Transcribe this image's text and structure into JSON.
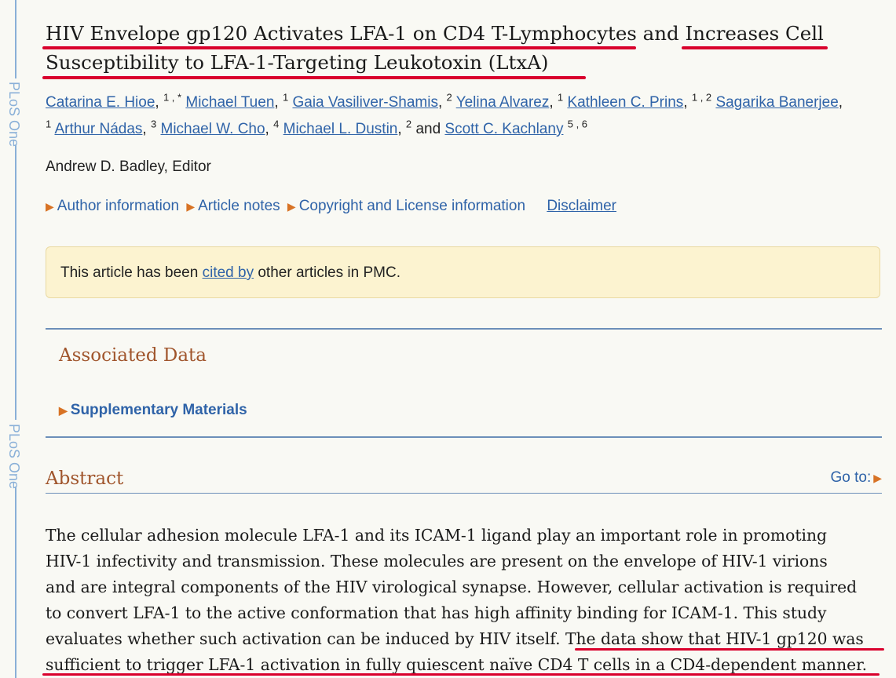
{
  "sidebar": {
    "journal_label": "PLoS One"
  },
  "article": {
    "title_lines": [
      "HIV Envelope gp120 Activates LFA-1 on CD4 T-Lymphocytes and Increases Cell",
      "Susceptibility to LFA-1-Targeting Leukotoxin (LtxA)"
    ],
    "authors": [
      {
        "name": "Catarina E. Hioe",
        "sup": "1 , *"
      },
      {
        "name": "Michael Tuen",
        "sup": "1"
      },
      {
        "name": "Gaia Vasiliver-Shamis",
        "sup": "2"
      },
      {
        "name": "Yelina Alvarez",
        "sup": "1"
      },
      {
        "name": "Kathleen C. Prins",
        "sup": "1 , 2"
      },
      {
        "name": "Sagarika Banerjee",
        "sup": "1"
      },
      {
        "name": "Arthur Nádas",
        "sup": "3"
      },
      {
        "name": "Michael W. Cho",
        "sup": "4"
      },
      {
        "name": "Michael L. Dustin",
        "sup": "2"
      },
      {
        "name": "Scott C. Kachlany",
        "sup": "5 , 6"
      }
    ],
    "and_text": "and",
    "editor": "Andrew D. Badley, Editor",
    "info_links": [
      "Author information",
      "Article notes",
      "Copyright and License information"
    ],
    "disclaimer": "Disclaimer"
  },
  "cited_box": {
    "prefix": "This article has been ",
    "link": "cited by",
    "suffix": " other articles in PMC."
  },
  "associated": {
    "heading": "Associated Data",
    "supplementary": "Supplementary Materials"
  },
  "abstract": {
    "heading": "Abstract",
    "goto": "Go to:",
    "lines": [
      "The cellular adhesion molecule LFA-1 and its ICAM-1 ligand play an important role in promoting",
      "HIV-1 infectivity and transmission. These molecules are present on the envelope of HIV-1 virions",
      "and are integral components of the HIV virological synapse. However, cellular activation is required",
      "to convert LFA-1 to the active conformation that has high affinity binding for ICAM-1. This study",
      "evaluates whether such activation can be induced by HIV itself. The data show that HIV-1 gp120 was",
      "sufficient to trigger LFA-1 activation in fully quiescent naïve CD4 T cells in a CD4-dependent manner."
    ]
  },
  "colors": {
    "highlight": "#d9002c",
    "link": "#2f63a8",
    "heading": "#a0552c",
    "accent": "#d87325"
  }
}
